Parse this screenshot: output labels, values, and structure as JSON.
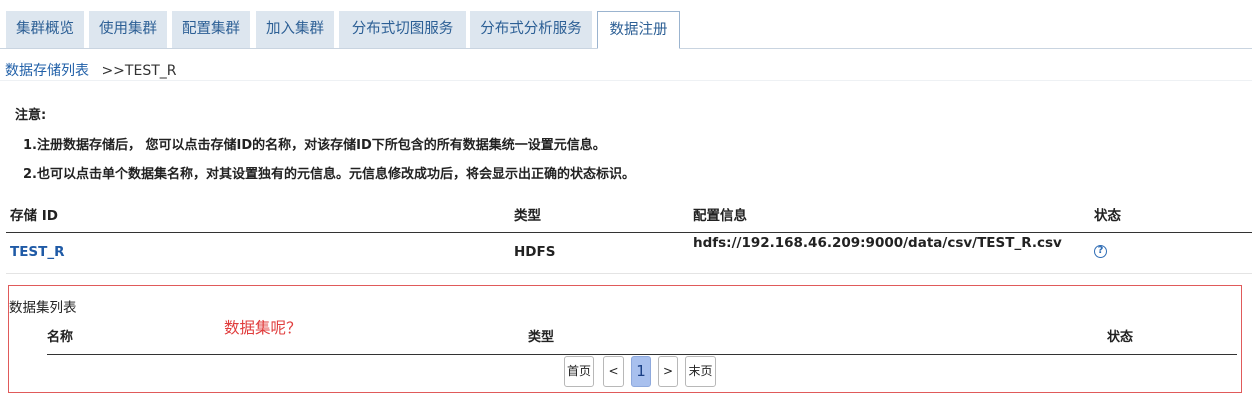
{
  "tabs": [
    {
      "label": "集群概览"
    },
    {
      "label": "使用集群"
    },
    {
      "label": "配置集群"
    },
    {
      "label": "加入集群"
    },
    {
      "label": "分布式切图服务"
    },
    {
      "label": "分布式分析服务"
    },
    {
      "label": "数据注册",
      "active": true
    }
  ],
  "breadcrumb": {
    "link": "数据存储列表",
    "separator": ">>",
    "current": "TEST_R"
  },
  "notes": {
    "title": "注意:",
    "line1": "1.注册数据存储后， 您可以点击存储ID的名称，对该存储ID下所包含的所有数据集统一设置元信息。",
    "line2": "2.也可以点击单个数据集名称，对其设置独有的元信息。元信息修改成功后，将会显示出正确的状态标识。"
  },
  "storage_table": {
    "headers": {
      "id": "存储 ID",
      "type": "类型",
      "config": "配置信息",
      "status": "状态"
    },
    "row": {
      "id": "TEST_R",
      "type": "HDFS",
      "config": "hdfs://192.168.46.209:9000/data/csv/TEST_R.csv",
      "status_icon": "question-circle-icon",
      "status_glyph": "?"
    }
  },
  "dataset_list": {
    "title": "数据集列表",
    "headers": {
      "name": "名称",
      "type": "类型",
      "status": "状态"
    },
    "annotation": "数据集呢？"
  },
  "pagination": {
    "first": "首页",
    "prev": "<",
    "page": "1",
    "next": ">",
    "last": "末页"
  },
  "colors": {
    "tab_bg": "#dde6ef",
    "tab_text": "#2c5f95",
    "link": "#1f5aa6",
    "annotation": "#e03c3c",
    "page_active": "#a8c0ee"
  }
}
